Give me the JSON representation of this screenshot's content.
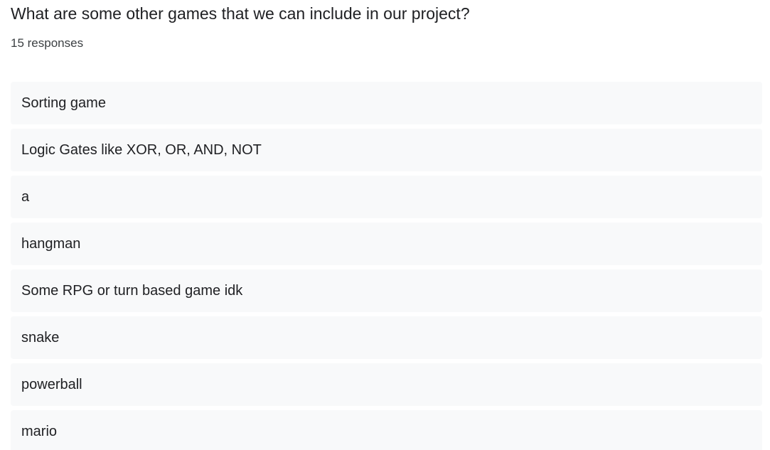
{
  "question": {
    "title": "What are some other games that we can include in our project?",
    "response_count": "15 responses"
  },
  "responses": [
    "Sorting game",
    "Logic Gates like XOR, OR, AND, NOT",
    "a",
    "hangman",
    "Some RPG or turn based game idk",
    "snake",
    "powerball",
    "mario"
  ],
  "colors": {
    "item_background": "#f8f9fa",
    "text": "#202124",
    "secondary_text": "#3c4043"
  }
}
